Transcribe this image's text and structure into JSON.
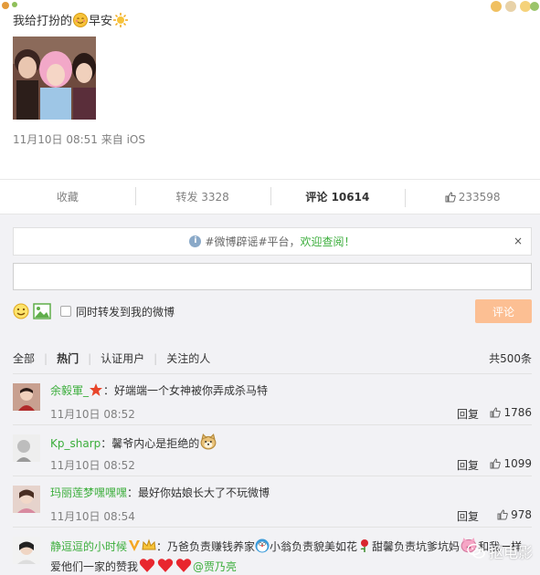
{
  "post": {
    "text_before": "我给打扮的",
    "text_after": "早安",
    "meta": "11月10日 08:51 来自 iOS"
  },
  "actions": {
    "favorite": "收藏",
    "repost": "转发 3328",
    "comment": "评论 10614",
    "like": "233598"
  },
  "notice": {
    "prefix": "#微博辟谣#平台，",
    "link": "欢迎查阅！",
    "close": "×"
  },
  "compose": {
    "input_value": "",
    "repost_label": "同时转发到我的微博",
    "submit": "评论"
  },
  "filters": {
    "all": "全部",
    "hot": "热门",
    "verified": "认证用户",
    "following": "关注的人",
    "total": "共500条"
  },
  "comments": [
    {
      "user": "余毅軍_",
      "text": "：好端端一个女神被你弄成杀马特",
      "time": "11月10日 08:52",
      "reply": "回复",
      "likes": "1786"
    },
    {
      "user": "Kp_sharp",
      "text": "：馨爷内心是拒绝的",
      "time": "11月10日 08:52",
      "reply": "回复",
      "likes": "1099"
    },
    {
      "user": "玛丽莲梦嘿嘿嘿",
      "text": "：最好你姑娘长大了不玩微博",
      "time": "11月10日 08:54",
      "reply": "回复",
      "likes": "978"
    }
  ],
  "last_comment": {
    "user": "静逗逗的小时候",
    "part1": "：乃爸负责赚钱养家",
    "part2": "小翁负责貌美如花",
    "part3": "甜馨负责坑爹坑妈",
    "part4": "和我一样爱他们一家的赞我",
    "mention": "@贾乃亮"
  },
  "watermark": {
    "text": "抠电影"
  },
  "colors": {
    "accent_green": "#3cae3c",
    "submit_bg": "#fcbf93",
    "panel_bg": "#f2f2f5"
  }
}
